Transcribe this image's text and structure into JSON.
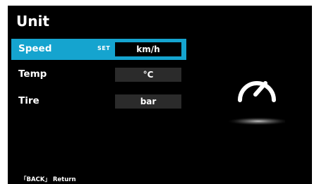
{
  "page": {
    "title": "Unit"
  },
  "rows": [
    {
      "label": "Speed",
      "tag": "SET",
      "value": "km/h"
    },
    {
      "label": "Temp",
      "tag": "",
      "value": "°C"
    },
    {
      "label": "Tire",
      "tag": "",
      "value": "bar"
    }
  ],
  "icons": {
    "gauge": "speedometer-icon"
  },
  "colors": {
    "accent": "#15a4cf",
    "value_box": "#2b2b2b",
    "background": "#000000"
  },
  "footer": {
    "hint": "「BACK」 Return"
  }
}
